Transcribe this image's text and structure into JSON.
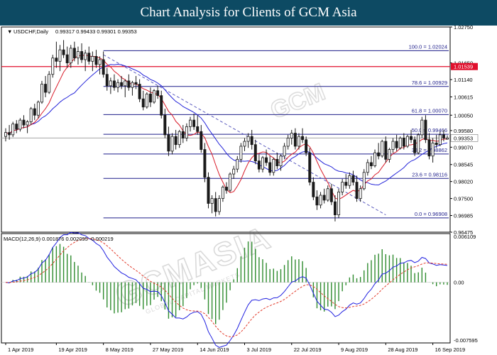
{
  "banner": {
    "title": "Chart Analysis for Clients of GCM Asia"
  },
  "chart_data": [
    {
      "type": "candlestick",
      "symbol_label": "USDCHF,Daily",
      "ohlc_label": "0.99317 0.99433 0.99301 0.99353",
      "current_price": 0.99353,
      "current_price_label": "0.99353",
      "ylim": [
        0.9647,
        1.0275
      ],
      "ytick_values": [
        1.0275,
        1.0165,
        1.0114,
        1.0061,
        1.0005,
        0.9958,
        0.9907,
        0.9854,
        0.9802,
        0.975,
        0.9698,
        0.9647
      ],
      "ytick_labels": [
        "1.02750",
        "1.01650",
        "1.01140",
        "1.00615",
        "1.00050",
        "0.99580",
        "0.99070",
        "0.98545",
        "0.98020",
        "0.97500",
        "0.96985",
        "0.96475"
      ],
      "x_labels": [
        "1 Apr 2019",
        "19 Apr 2019",
        "8 May 2019",
        "27 May 2019",
        "14 Jun 2019",
        "3 Jul 2019",
        "22 Jul 2019",
        "9 Aug 2019",
        "28 Aug 2019",
        "16 Sep 2019"
      ],
      "x_label_index": [
        0,
        14,
        27,
        40,
        53,
        66,
        79,
        92,
        105,
        118
      ],
      "candles": [
        [
          0.994,
          0.9965,
          0.9925,
          0.9952
        ],
        [
          0.9952,
          0.9975,
          0.993,
          0.9945
        ],
        [
          0.9945,
          0.9985,
          0.9938,
          0.9978
        ],
        [
          0.9978,
          0.999,
          0.995,
          0.9962
        ],
        [
          0.9962,
          0.9996,
          0.9955,
          0.999
        ],
        [
          0.999,
          1.0005,
          0.9965,
          0.9975
        ],
        [
          0.9975,
          0.999,
          0.995,
          0.9985
        ],
        [
          0.9985,
          1.003,
          0.9975,
          1.0025
        ],
        [
          1.0025,
          1.004,
          0.999,
          1.0005
        ],
        [
          1.0005,
          1.005,
          0.9995,
          1.0045
        ],
        [
          1.0045,
          1.011,
          1.004,
          1.01
        ],
        [
          1.01,
          1.0125,
          1.006,
          1.0075
        ],
        [
          1.0075,
          1.014,
          1.007,
          1.013
        ],
        [
          1.013,
          1.019,
          1.012,
          1.018
        ],
        [
          1.018,
          1.023,
          1.015,
          1.017
        ],
        [
          1.017,
          1.022,
          1.014,
          1.0205
        ],
        [
          1.0205,
          1.0235,
          1.018,
          1.019
        ],
        [
          1.019,
          1.0215,
          1.015,
          1.0165
        ],
        [
          1.0165,
          1.022,
          1.015,
          1.021
        ],
        [
          1.021,
          1.023,
          1.017,
          1.018
        ],
        [
          1.018,
          1.0215,
          1.016,
          1.02
        ],
        [
          1.02,
          1.0225,
          1.0165,
          1.0175
        ],
        [
          1.0175,
          1.0205,
          1.014,
          1.0195
        ],
        [
          1.0195,
          1.0215,
          1.016,
          1.017
        ],
        [
          1.017,
          1.02,
          1.014,
          1.0185
        ],
        [
          1.0185,
          1.0205,
          1.015,
          1.016
        ],
        [
          1.016,
          1.0185,
          1.013,
          1.0175
        ],
        [
          1.0175,
          1.02,
          1.012,
          1.013
        ],
        [
          1.013,
          1.015,
          1.008,
          1.0095
        ],
        [
          1.0095,
          1.012,
          1.007,
          1.011
        ],
        [
          1.011,
          1.013,
          1.008,
          1.009
        ],
        [
          1.009,
          1.0115,
          1.0075,
          1.0105
        ],
        [
          1.0105,
          1.0125,
          1.0085,
          1.0095
        ],
        [
          1.0095,
          1.0115,
          1.006,
          1.011
        ],
        [
          1.011,
          1.013,
          1.008,
          1.009
        ],
        [
          1.009,
          1.011,
          1.0065,
          1.0105
        ],
        [
          1.0105,
          1.0125,
          1.0085,
          1.01
        ],
        [
          1.01,
          1.0115,
          1.0045,
          1.0055
        ],
        [
          1.0055,
          1.008,
          1.002,
          1.003
        ],
        [
          1.003,
          1.0075,
          1.0025,
          1.007
        ],
        [
          1.007,
          1.009,
          1.003,
          1.0045
        ],
        [
          1.0045,
          1.0085,
          1.004,
          1.008
        ],
        [
          1.008,
          1.0095,
          1.0055,
          1.0065
        ],
        [
          1.0065,
          1.008,
          0.9995,
          1.0005
        ],
        [
          1.0005,
          1.0025,
          0.9935,
          0.9945
        ],
        [
          0.9945,
          0.997,
          0.988,
          0.9895
        ],
        [
          0.9895,
          0.995,
          0.9885,
          0.994
        ],
        [
          0.994,
          0.996,
          0.99,
          0.9915
        ],
        [
          0.9915,
          0.996,
          0.9905,
          0.9955
        ],
        [
          0.9955,
          0.9975,
          0.992,
          0.9935
        ],
        [
          0.9935,
          0.998,
          0.9925,
          0.997
        ],
        [
          0.997,
          1.0,
          0.9955,
          0.999
        ],
        [
          0.999,
          1.001,
          0.996,
          0.997
        ],
        [
          0.997,
          1.0005,
          0.9945,
          0.9955
        ],
        [
          0.9955,
          0.9975,
          0.989,
          0.99
        ],
        [
          0.99,
          0.992,
          0.98,
          0.9815
        ],
        [
          0.9815,
          0.983,
          0.972,
          0.9735
        ],
        [
          0.9735,
          0.976,
          0.9705,
          0.975
        ],
        [
          0.975,
          0.977,
          0.9695,
          0.971
        ],
        [
          0.971,
          0.976,
          0.97,
          0.975
        ],
        [
          0.975,
          0.979,
          0.974,
          0.9785
        ],
        [
          0.9785,
          0.98,
          0.9765,
          0.9775
        ],
        [
          0.9775,
          0.983,
          0.977,
          0.9825
        ],
        [
          0.9825,
          0.985,
          0.981,
          0.984
        ],
        [
          0.984,
          0.988,
          0.983,
          0.987
        ],
        [
          0.987,
          0.992,
          0.986,
          0.991
        ],
        [
          0.991,
          0.9935,
          0.9895,
          0.9925
        ],
        [
          0.9925,
          0.995,
          0.9905,
          0.994
        ],
        [
          0.994,
          0.996,
          0.99,
          0.9915
        ],
        [
          0.9915,
          0.993,
          0.9855,
          0.9865
        ],
        [
          0.9865,
          0.9885,
          0.983,
          0.984
        ],
        [
          0.984,
          0.988,
          0.983,
          0.9875
        ],
        [
          0.9875,
          0.99,
          0.985,
          0.986
        ],
        [
          0.986,
          0.988,
          0.982,
          0.983
        ],
        [
          0.983,
          0.9875,
          0.982,
          0.987
        ],
        [
          0.987,
          0.989,
          0.984,
          0.985
        ],
        [
          0.985,
          0.9885,
          0.9835,
          0.988
        ],
        [
          0.988,
          0.992,
          0.987,
          0.991
        ],
        [
          0.991,
          0.9945,
          0.99,
          0.9935
        ],
        [
          0.9935,
          0.996,
          0.9915,
          0.995
        ],
        [
          0.995,
          0.9965,
          0.99,
          0.991
        ],
        [
          0.991,
          0.995,
          0.99,
          0.994
        ],
        [
          0.994,
          0.9965,
          0.992,
          0.993
        ],
        [
          0.993,
          0.994,
          0.988,
          0.989
        ],
        [
          0.989,
          0.9905,
          0.979,
          0.98
        ],
        [
          0.98,
          0.9815,
          0.9745,
          0.9755
        ],
        [
          0.9755,
          0.9775,
          0.9715,
          0.973
        ],
        [
          0.973,
          0.977,
          0.972,
          0.976
        ],
        [
          0.976,
          0.978,
          0.9735,
          0.9745
        ],
        [
          0.9745,
          0.979,
          0.974,
          0.978
        ],
        [
          0.978,
          0.9795,
          0.973,
          0.974
        ],
        [
          0.974,
          0.976,
          0.968,
          0.97
        ],
        [
          0.97,
          0.978,
          0.969,
          0.977
        ],
        [
          0.977,
          0.981,
          0.976,
          0.98
        ],
        [
          0.98,
          0.9825,
          0.978,
          0.979
        ],
        [
          0.979,
          0.983,
          0.978,
          0.982
        ],
        [
          0.982,
          0.9835,
          0.979,
          0.98
        ],
        [
          0.98,
          0.982,
          0.974,
          0.975
        ],
        [
          0.975,
          0.979,
          0.974,
          0.978
        ],
        [
          0.978,
          0.984,
          0.9775,
          0.983
        ],
        [
          0.983,
          0.987,
          0.982,
          0.986
        ],
        [
          0.986,
          0.988,
          0.984,
          0.985
        ],
        [
          0.985,
          0.99,
          0.9845,
          0.989
        ],
        [
          0.989,
          0.992,
          0.987,
          0.988
        ],
        [
          0.988,
          0.993,
          0.9875,
          0.9925
        ],
        [
          0.9925,
          0.994,
          0.986,
          0.987
        ],
        [
          0.987,
          0.9905,
          0.986,
          0.99
        ],
        [
          0.99,
          0.9935,
          0.989,
          0.9925
        ],
        [
          0.9925,
          0.9945,
          0.9895,
          0.9905
        ],
        [
          0.9905,
          0.994,
          0.99,
          0.9935
        ],
        [
          0.9935,
          0.995,
          0.99,
          0.991
        ],
        [
          0.991,
          0.9945,
          0.9905,
          0.994
        ],
        [
          0.994,
          0.996,
          0.992,
          0.993
        ],
        [
          0.993,
          0.994,
          0.988,
          0.989
        ],
        [
          0.989,
          0.995,
          0.9885,
          0.9945
        ],
        [
          0.9945,
          1.0,
          0.9935,
          0.999
        ],
        [
          0.999,
          1.0005,
          0.992,
          0.993
        ],
        [
          0.993,
          0.995,
          0.987,
          0.988
        ],
        [
          0.988,
          0.9935,
          0.986,
          0.992
        ],
        [
          0.992,
          0.9945,
          0.9905,
          0.9915
        ],
        [
          0.9915,
          0.9955,
          0.991,
          0.9945
        ],
        [
          0.9945,
          0.996,
          0.9925,
          0.9935
        ],
        [
          0.99317,
          0.99433,
          0.99301,
          0.99353
        ]
      ],
      "fibonacci": [
        {
          "label": "100.0 = 1.02024",
          "value": 1.02024
        },
        {
          "label": "78.6 = 1.00929",
          "value": 1.00929
        },
        {
          "label": "61.8 = 1.00070",
          "value": 1.0007
        },
        {
          "label": "50.0 = 0.99466",
          "value": 0.99466
        },
        {
          "label": "38.2 = 0.98862",
          "value": 0.98862
        },
        {
          "label": "23.6 = 0.98116",
          "value": 0.98116
        },
        {
          "label": "0.0 = 0.96908",
          "value": 0.96908
        }
      ],
      "horizontal_line": {
        "value": 1.01539,
        "label": "1.01539",
        "color": "#e0102d"
      },
      "trendline": {
        "from": [
          27,
          1.019
        ],
        "to": [
          105,
          0.97
        ],
        "color": "#4b4bb8"
      },
      "colors": {
        "fib": "#1d1d8a",
        "ma_fast": "#d91c2a",
        "ma_slow": "#2424d9",
        "candle": "#1a1a1a",
        "current": "#999999"
      },
      "grid": false
    },
    {
      "type": "macd",
      "label": "MACD(12,26,9) 0.001876 0.002095 -0.000219",
      "ylim": [
        -0.007595,
        0.006109
      ],
      "ytick_values": [
        0.006109,
        0.0,
        -0.007595
      ],
      "ytick_labels": [
        "0.006109",
        "0.00",
        "-0.007595"
      ],
      "colors": {
        "macd": "#2020e0",
        "signal": "#e33b2b",
        "hist": "#2e8b2e"
      },
      "grid": false
    }
  ],
  "watermark": {
    "text": "GCMASIA",
    "subtext": "GLOBAL CAPITAL MARKETS",
    "logo_text": "GCM"
  }
}
